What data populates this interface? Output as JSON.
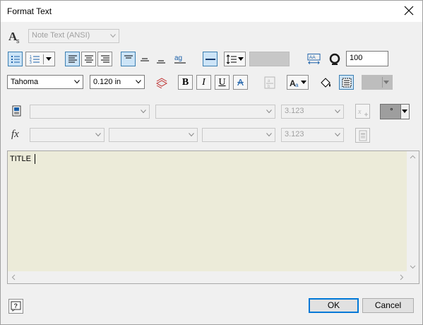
{
  "dialog": {
    "title": "Format Text",
    "close_glyph": "✕"
  },
  "row1": {
    "style_select": "Note Text (ANSI)",
    "style_icon": "text-style-icon"
  },
  "row2": {
    "width_scale": "100",
    "icons": [
      "bullets-icon",
      "numbered-list-icon",
      "align-left-icon",
      "align-center-icon",
      "align-right-icon",
      "valign-top-icon",
      "valign-middle-icon",
      "valign-bottom-icon",
      "stack-text-icon",
      "line-weight-icon",
      "line-spacing-icon",
      "text-fit-icon",
      "rotate-icon"
    ]
  },
  "row3": {
    "font": "Tahoma",
    "size": "0.120 in",
    "bold": "B",
    "italic": "I",
    "underline": "U",
    "strike": "A"
  },
  "row4": {
    "value": "3.123"
  },
  "row5": {
    "fx_label": "fx",
    "value": "3.123"
  },
  "editor": {
    "text": "TITLE"
  },
  "footer": {
    "ok_label": "OK",
    "cancel_label": "Cancel",
    "help_glyph": "?"
  }
}
